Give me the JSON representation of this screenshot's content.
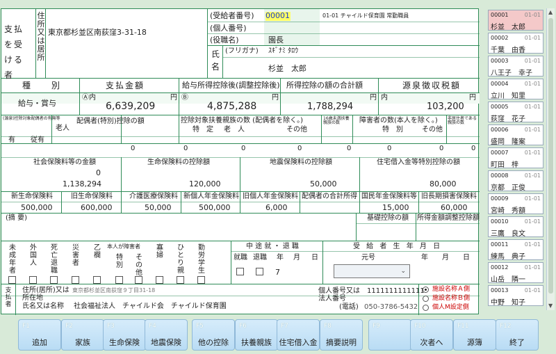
{
  "payee": {
    "header_pay": "支払を受ける者",
    "address_label": "住所又は居所",
    "address": "東京都杉並区南荻窪3-31-18",
    "recipient_no_label": "(受給者番号)",
    "recipient_no": "00001",
    "recipient_info": "01-01 チャイルド保育園 常勤職員",
    "personal_no_label": "(個人番号)",
    "position_label": "(役職名)",
    "position": "園長",
    "name_label": "氏名",
    "furigana_label": "(フリガナ)",
    "furigana": "ｽｷﾞﾅﾐ ﾀﾛｳ",
    "name": "杉並　太郎"
  },
  "amounts": {
    "type_header": "種　　別",
    "pay_header": "支払金額",
    "after_deduction_header": "給与所得控除後(調整控除後)",
    "deduction_total_header": "所得控除の額の合計額",
    "withholding_header": "源泉徴収税額",
    "type": "給与・賞与",
    "circle_a": "Ⓐ内",
    "circle_b": "Ⓑ",
    "pay_amount": "6,639,209",
    "after_deduction": "4,875,288",
    "deduction_total": "1,788,294",
    "withholding_prefix": "内",
    "withholding": "103,200",
    "yen": "円"
  },
  "dependents": {
    "col1_header": "(源泉)控除対象配偶者の有無等",
    "elderly": "老人",
    "spouse_header": "配偶者(特別)控除の額",
    "dep_header": "控除対象扶養親族の数 (配偶者を除く。)",
    "special": "特　定",
    "old": "老　人",
    "other": "その他",
    "under16": "16歳未満扶養親族の数",
    "disabled_header": "障害者の数(本人を除く。)",
    "special2": "特　別",
    "other2": "その他",
    "nonresident": "非居住者である親族の数",
    "yes": "有",
    "jugen": "従有",
    "person": "人",
    "inside": "内",
    "jugen_person": "従人",
    "values": [
      "0",
      "0",
      "0",
      "0",
      "0",
      "0",
      "0",
      "0"
    ]
  },
  "insurance": {
    "social_header": "社会保険料等の金額",
    "life_header": "生命保険料の控除額",
    "quake_header": "地震保険料の控除額",
    "housing_header": "住宅借入金等特別控除の額",
    "social_inner": "0",
    "social": "1,138,294",
    "life": "120,000",
    "quake": "50,000",
    "housing": "80,000",
    "new_life_header": "新生命保険料",
    "old_life_header": "旧生命保険料",
    "care_header": "介護医療保険料",
    "new_pension_header": "新個人年金保険料",
    "old_pension_header": "旧個人年金保険料",
    "spouse_income_header": "配偶者の合計所得",
    "national_pension_header": "国民年金保険料等",
    "old_long_header": "旧長期損害保険料",
    "new_life": "500,000",
    "old_life": "600,000",
    "care": "50,000",
    "new_pension": "500,000",
    "old_pension": "6,000",
    "national_pension": "15,000",
    "old_long": "60,000",
    "remarks_label": "(摘 要)",
    "basic_deduction_header": "基礎控除の額",
    "income_adjust_header": "所得金額調整控除額"
  },
  "flags": {
    "minor": "未成年者",
    "foreigner": "外国人",
    "death": "死亡退職",
    "disaster": "災害者",
    "otsu": "乙欄",
    "self_disabled": "本人が障害者",
    "special": "特別",
    "other": "その他",
    "widow": "寡婦",
    "single_parent": "ひとり親",
    "working_student": "勤労学生",
    "midyear_header": "中 途 就 ・ 退 職",
    "employed": "就職",
    "retired": "退職",
    "year": "年",
    "month": "月",
    "day": "日",
    "month_value": "7",
    "birth_header": "受 給 者 生 年 月 日",
    "era": "元号",
    "year2": "年",
    "month2": "月",
    "day2": "日"
  },
  "payer": {
    "label": "支払者",
    "address_label": "住所(居所)又は所在地",
    "address": "東京都杉並区南荻窪９丁目31-18",
    "name_label": "氏名又は名称",
    "name": "社会福祉法人　チャイルド会　チャイルド保育園",
    "corp_no_label": "個人番号又は法人番号",
    "corp_no": "1111111111111",
    "phone_label": "(電話)",
    "phone": "050-3786-5432",
    "radio_a": "施設名称Ａ側",
    "radio_b": "施設名称Ｂ側",
    "radio_m": "個人M設定側"
  },
  "employees": [
    {
      "no": "00001",
      "code": "01-01",
      "name": "杉並　太郎"
    },
    {
      "no": "00002",
      "code": "01-01",
      "name": "千葉　由香"
    },
    {
      "no": "00003",
      "code": "01-01",
      "name": "八王子　幸子"
    },
    {
      "no": "00004",
      "code": "01-01",
      "name": "立川　知里"
    },
    {
      "no": "00005",
      "code": "01-01",
      "name": "荻窪　花子"
    },
    {
      "no": "00006",
      "code": "01-01",
      "name": "盛岡　隆案"
    },
    {
      "no": "00007",
      "code": "01-01",
      "name": "町田　梓"
    },
    {
      "no": "00008",
      "code": "01-01",
      "name": "京都　正俊"
    },
    {
      "no": "00009",
      "code": "01-01",
      "name": "宮崎　秀額"
    },
    {
      "no": "00010",
      "code": "01-01",
      "name": "三鷹　良文"
    },
    {
      "no": "00011",
      "code": "01-01",
      "name": "練馬　典子"
    },
    {
      "no": "00012",
      "code": "01-01",
      "name": "山岳　隣一"
    },
    {
      "no": "00013",
      "code": "01-01",
      "name": "中野　知子"
    }
  ],
  "fkeys": [
    {
      "key": "F1",
      "label": "追加"
    },
    {
      "key": "F2",
      "label": "家族"
    },
    {
      "key": "F3",
      "label": "生命保険"
    },
    {
      "key": "F4",
      "label": "地震保険"
    },
    {
      "key": "F5",
      "label": "他の控除"
    },
    {
      "key": "F6",
      "label": "扶養親族"
    },
    {
      "key": "F7",
      "label": "住宅借入金"
    },
    {
      "key": "F8",
      "label": "摘要説明"
    },
    {
      "key": "F9",
      "label": ""
    },
    {
      "key": "F10",
      "label": "次者へ"
    },
    {
      "key": "F11",
      "label": "源簿"
    },
    {
      "key": "F12",
      "label": "終了"
    }
  ],
  "colors": {
    "accent": "#2e8b57",
    "highlight": "#ffff66",
    "selected": "#f4c9c9",
    "red": "#cc0000"
  }
}
